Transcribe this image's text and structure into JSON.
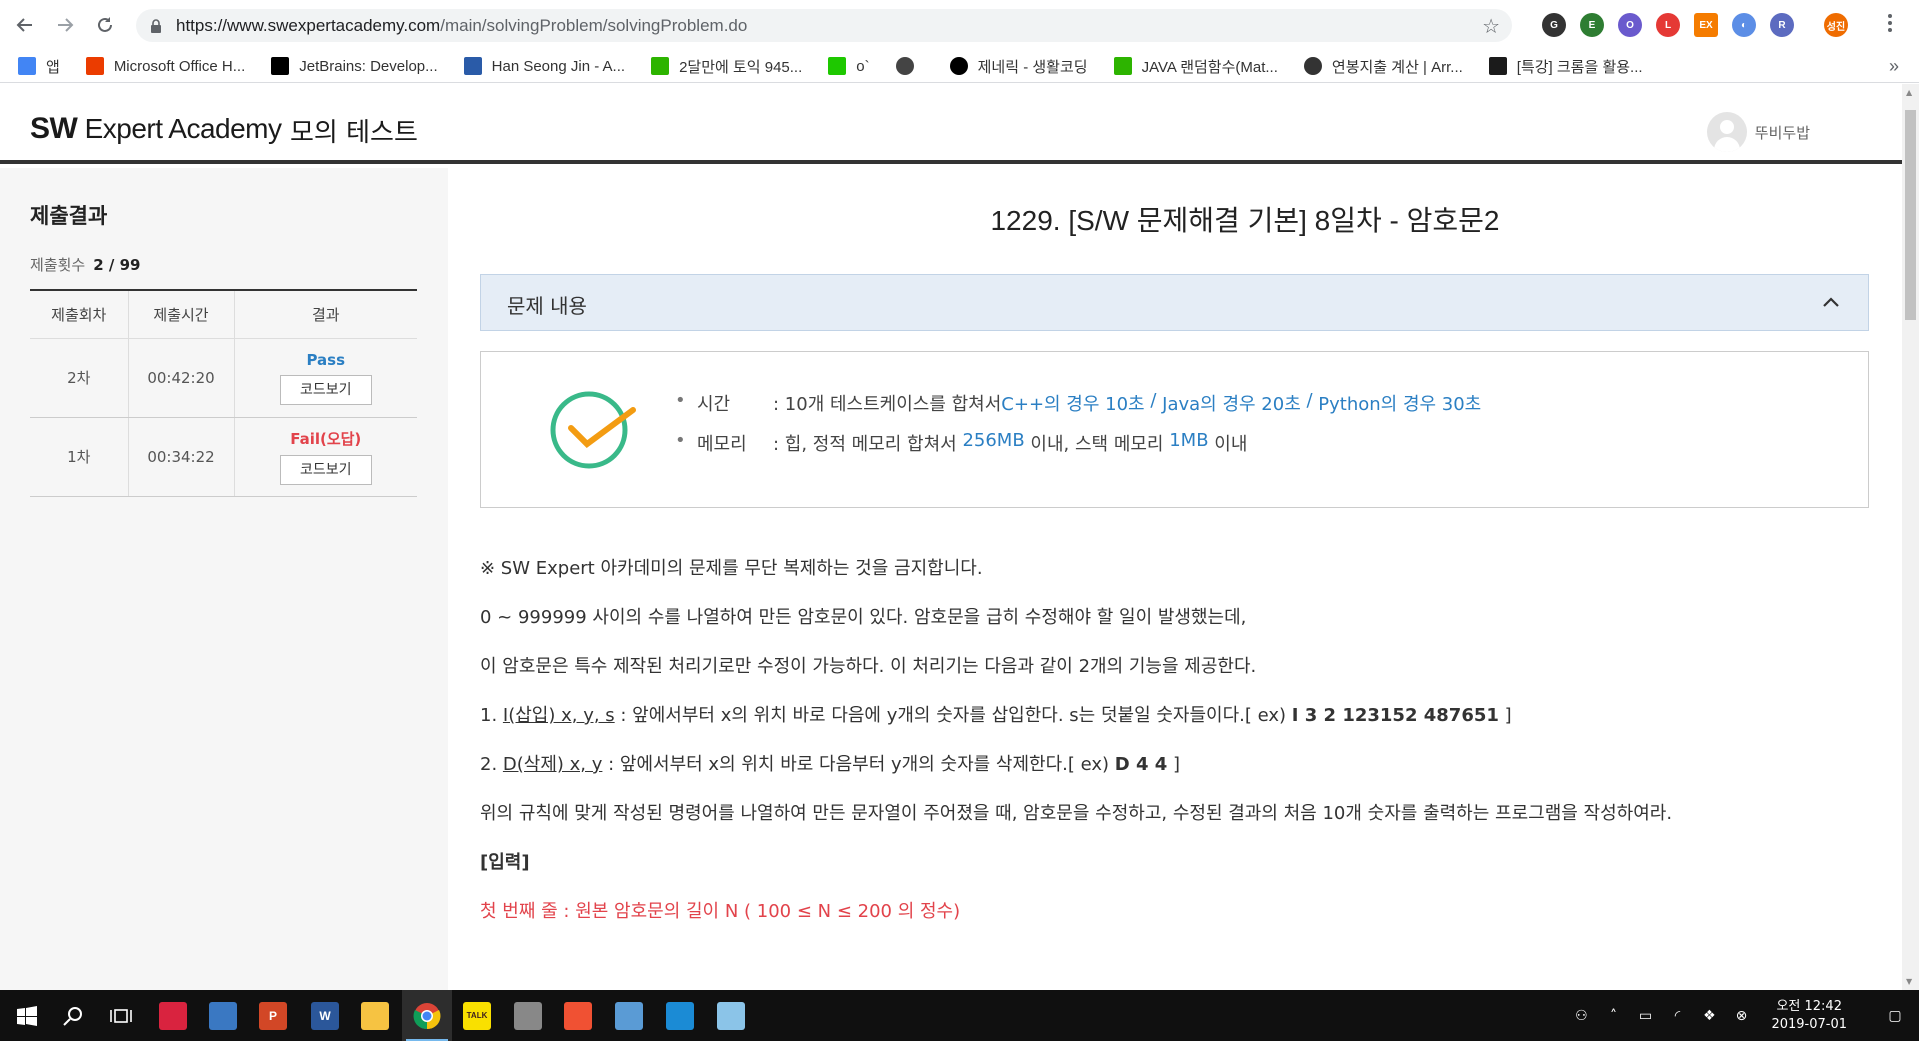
{
  "browser": {
    "url_host": "https://www.swexpertacademy.com",
    "url_path": "/main/solvingProblem/solvingProblem.do",
    "bookmarks": [
      {
        "label": "앱",
        "icon": "apps-grid-icon",
        "color": "#4285f4"
      },
      {
        "label": "Microsoft Office H...",
        "icon": "office-icon",
        "color": "#eb3c00"
      },
      {
        "label": "JetBrains: Develop...",
        "icon": "jetbrains-icon",
        "color": "#000000"
      },
      {
        "label": "Han Seong Jin - A...",
        "icon": "atcoder-icon",
        "color": "#2a5ba8"
      },
      {
        "label": "2달만에 토익 945...",
        "icon": "blog-icon",
        "color": "#2db400"
      },
      {
        "label": "o`",
        "icon": "naver-icon",
        "color": "#1ec800"
      },
      {
        "label": "",
        "icon": "globe-icon",
        "color": "#444444"
      },
      {
        "label": "제네릭 - 생활코딩",
        "icon": "opentutorials-icon",
        "color": "#000000"
      },
      {
        "label": "JAVA 랜덤함수(Mat...",
        "icon": "blog-icon",
        "color": "#2db400"
      },
      {
        "label": "연봉지출 계산 | Arr...",
        "icon": "cloud-icon",
        "color": "#333333"
      },
      {
        "label": "[특강] 크롬을 활용...",
        "icon": "inflearn-icon",
        "color": "#1b1b1b"
      }
    ],
    "profile_initials": "성진"
  },
  "header": {
    "logo_sw": "SW",
    "logo_rest": " Expert Academy",
    "page_label": "모의 테스트",
    "username": "뚜비두밥"
  },
  "sidebar": {
    "title": "제출결과",
    "count_label": "제출횟수",
    "count_value": "2 / 99",
    "columns": [
      "제출회차",
      "제출시간",
      "결과"
    ],
    "rows": [
      {
        "round": "2차",
        "time": "00:42:20",
        "result": "Pass",
        "status": "pass",
        "code_btn": "코드보기"
      },
      {
        "round": "1차",
        "time": "00:34:22",
        "result": "Fail(오답)",
        "status": "fail",
        "code_btn": "코드보기"
      }
    ]
  },
  "problem": {
    "title": "1229. [S/W 문제해결 기본] 8일차 - 암호문2",
    "section_label": "문제 내용",
    "limits": {
      "time_label": "시간",
      "time_prefix": ": 10개 테스트케이스를 합쳐서 ",
      "time_cpp": "C++의 경우 10초",
      "time_java": "Java의 경우 20초",
      "time_python": "Python의 경우 30초",
      "sep": " / ",
      "mem_label": "메모리",
      "mem_prefix": ": 힙, 정적 메모리 합쳐서 ",
      "mem_heap": "256MB",
      "mem_mid": " 이내, 스택 메모리 ",
      "mem_stack": "1MB",
      "mem_suffix": " 이내"
    },
    "notice": "※ SW Expert 아카데미의 문제를 무단 복제하는 것을 금지합니다.",
    "line1": "0 ~ 999999 사이의 수를 나열하여 만든 암호문이 있다. 암호문을 급히 수정해야 할 일이 발생했는데,",
    "line2": "이 암호문은 특수 제작된 처리기로만 수정이 가능하다. 이 처리기는 다음과 같이 2개의 기능을 제공한다.",
    "cmd1_num": "1. ",
    "cmd1_u": "I(삽입) x, y, s",
    "cmd1_text": " : 앞에서부터 x의 위치 바로 다음에 y개의 숫자를 삽입한다. s는 덧붙일 숫자들이다.[ ex) ",
    "cmd1_ex": "I 3 2 123152 487651",
    "cmd1_end": " ]",
    "cmd2_num": "2. ",
    "cmd2_u": "D(삭제) x, y",
    "cmd2_text": " : 앞에서부터 x의 위치 바로 다음부터 y개의 숫자를 삭제한다.[ ex) ",
    "cmd2_ex": "D 4 4",
    "cmd2_end": " ]",
    "line3": "위의 규칙에 맞게 작성된 명령어를 나열하여 만든 문자열이 주어졌을 때, 암호문을 수정하고, 수정된 결과의 처음 10개 숫자를 출력하는 프로그램을 작성하여라.",
    "input_heading": "[입력]",
    "input_line1": "첫 번째 줄 : 원본 암호문의 길이 N ( 100 ≤ N ≤ 200 의 정수)"
  },
  "taskbar": {
    "apps": [
      {
        "name": "start-button",
        "color": "#ffffff"
      },
      {
        "name": "search-icon",
        "color": "#ffffff"
      },
      {
        "name": "task-view-icon",
        "color": "#ffffff"
      },
      {
        "name": "sourcetree-app-icon",
        "color": "#d9233f"
      },
      {
        "name": "network-app-icon",
        "color": "#3a78c2"
      },
      {
        "name": "powerpoint-app-icon",
        "color": "#d24726",
        "letter": "P"
      },
      {
        "name": "word-app-icon",
        "color": "#2b579a",
        "letter": "W"
      },
      {
        "name": "file-explorer-app-icon",
        "color": "#f6c342"
      },
      {
        "name": "chrome-app-icon",
        "color": "#4285f4"
      },
      {
        "name": "kakaotalk-app-icon",
        "color": "#f9e000",
        "letter": "TALK"
      },
      {
        "name": "settings-app-icon",
        "color": "#888888"
      },
      {
        "name": "git-app-icon",
        "color": "#f05133"
      },
      {
        "name": "paint-app-icon",
        "color": "#5a9bd5"
      },
      {
        "name": "store-app-icon",
        "color": "#1b8bd5"
      },
      {
        "name": "notes-app-icon",
        "color": "#8bc4e8"
      }
    ],
    "clock_time": "오전 12:42",
    "clock_date": "2019-07-01"
  }
}
